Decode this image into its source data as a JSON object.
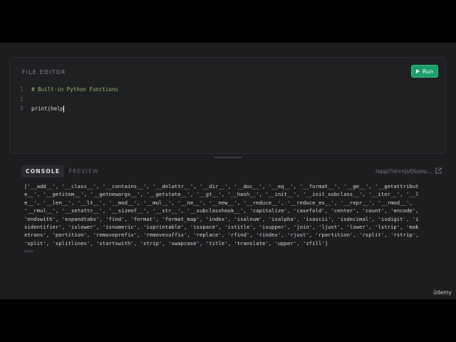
{
  "editor": {
    "title": "FILE EDITOR",
    "run_label": "Run",
    "lines": [
      {
        "num": "1",
        "text": "# Built-in Python Functions"
      },
      {
        "num": "2",
        "text": ""
      },
      {
        "num": "3",
        "text": "print(help"
      }
    ]
  },
  "console": {
    "tabs": [
      {
        "label": "CONSOLE",
        "active": true
      },
      {
        "label": "PREVIEW",
        "active": false
      }
    ],
    "url": "/app/?id=njufj&sou...",
    "output": "['__add__', '__class__', '__contains__', '__delattr__', '__dir__', '__doc__', '__eq__', '__format__', '__ge__', '__getattribute__', '__getitem__', '__getnewargs__', '__getstate__', '__gt__', '__hash__', '__init__', '__init_subclass__', '__iter__', '__le__', '__len__', '__lt__', '__mod__', '__mul__', '__ne__', '__new__', '__reduce__', '__reduce_ex__', '__repr__', '__rmod__', '__rmul__', '__setattr__', '__sizeof__', '__str__', '__subclasshook__', 'capitalize', 'casefold', 'center', 'count', 'encode', 'endswith', 'expandtabs', 'find', 'format', 'format_map', 'index', 'isalnum', 'isalpha', 'isascii', 'isdecimal', 'isdigit', 'isidentifier', 'islower', 'isnumeric', 'isprintable', 'isspace', 'istitle', 'isupper', 'join', 'ljust', 'lower', 'lstrip', 'maketrans', 'partition', 'removeprefix', 'removesuffix', 'replace', 'rfind', 'rindex', 'rjust', 'rpartition', 'rsplit', 'rstrip', 'split', 'splitlines', 'startswith', 'strip', 'swapcase', 'title', 'translate', 'upper', 'zfill']",
    "prompt": ">>>"
  },
  "watermark": "ûdemy",
  "colors": {
    "run_button": "#1e9e6a",
    "comment": "#9bb86e",
    "background": "#1c1d1f"
  },
  "icons": {
    "run": "play-icon",
    "external": "external-link-icon"
  }
}
